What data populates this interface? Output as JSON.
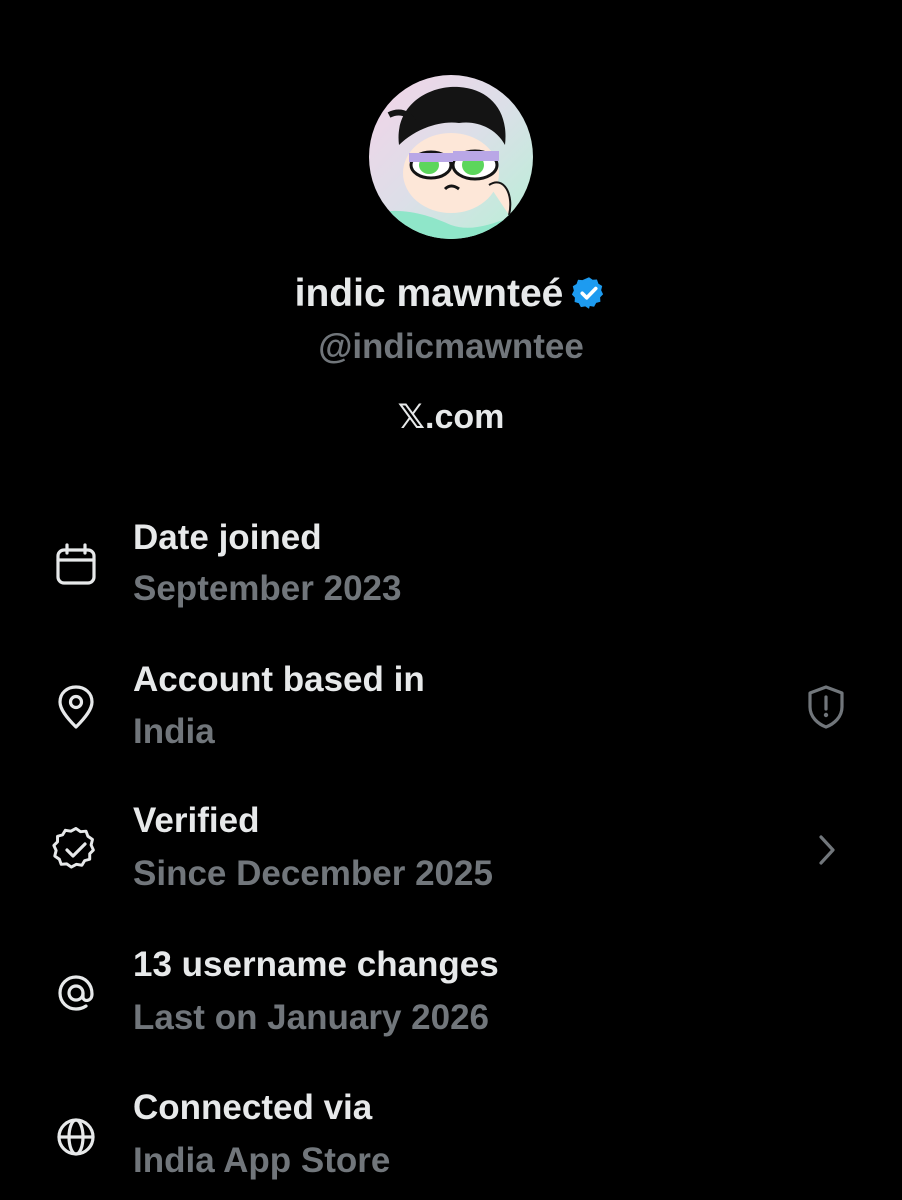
{
  "profile": {
    "display_name": "indic mawnteé",
    "handle": "@indicmawntee",
    "site": "𝕏.com",
    "avatar_icon": "cartoon-avatar",
    "verified_icon": "verified-badge-icon",
    "accent_color": "#1d9bf0"
  },
  "rows": [
    {
      "icon": "calendar-icon",
      "title": "Date joined",
      "subtitle": "September 2023"
    },
    {
      "icon": "location-pin-icon",
      "title": "Account based in",
      "subtitle": "India",
      "right_icon": "shield-alert-icon"
    },
    {
      "icon": "verified-check-icon",
      "title": "Verified",
      "subtitle": "Since December 2025",
      "right_icon": "chevron-right-icon"
    },
    {
      "icon": "at-sign-icon",
      "title": "13 username changes",
      "subtitle": "Last on January 2026"
    },
    {
      "icon": "globe-icon",
      "title": "Connected via",
      "subtitle": "India App Store"
    }
  ]
}
